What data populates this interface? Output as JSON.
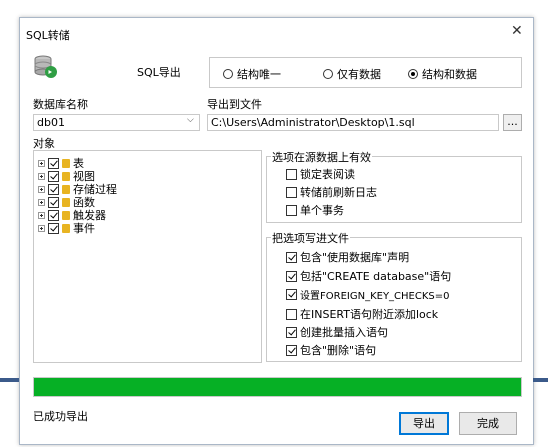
{
  "window": {
    "title": "SQL转储"
  },
  "header": {
    "export_label": "SQL导出",
    "radios": [
      {
        "label": "结构唯一",
        "selected": false
      },
      {
        "label": "仅有数据",
        "selected": false
      },
      {
        "label": "结构和数据",
        "selected": true
      }
    ]
  },
  "database": {
    "label": "数据库名称",
    "value": "db01"
  },
  "export_file": {
    "label": "导出到文件",
    "value": "C:\\Users\\Administrator\\Desktop\\1.sql",
    "browse_label": "..."
  },
  "objects": {
    "label": "对象",
    "items": [
      {
        "label": "表",
        "checked": true
      },
      {
        "label": "视图",
        "checked": true
      },
      {
        "label": "存储过程",
        "checked": true
      },
      {
        "label": "函数",
        "checked": true
      },
      {
        "label": "触发器",
        "checked": true
      },
      {
        "label": "事件",
        "checked": true
      }
    ]
  },
  "source_options": {
    "title": "选项在源数据上有效",
    "items": [
      {
        "label": "锁定表阅读",
        "checked": false
      },
      {
        "label": "转储前刷新日志",
        "checked": false
      },
      {
        "label": "单个事务",
        "checked": false
      }
    ]
  },
  "write_options": {
    "title": "把选项写进文件",
    "items": [
      {
        "label": "包含\"使用数据库\"声明",
        "checked": true
      },
      {
        "label": "包括\"CREATE database\"语句",
        "checked": true
      },
      {
        "label": "设置FOREIGN_KEY_CHECKS=0",
        "checked": true
      },
      {
        "label": "在INSERT语句附近添加lock",
        "checked": false
      },
      {
        "label": "创建批量插入语句",
        "checked": true
      },
      {
        "label": "包含\"删除\"语句",
        "checked": true
      }
    ]
  },
  "progress": {
    "fraction": 1.0,
    "color": "#06b025"
  },
  "status": {
    "text": "已成功导出"
  },
  "buttons": {
    "export": "导出",
    "done": "完成"
  }
}
